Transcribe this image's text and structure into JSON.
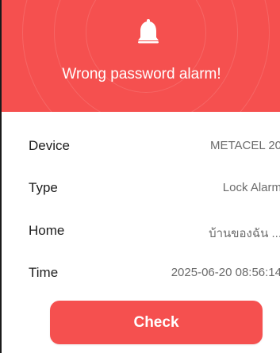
{
  "header": {
    "icon": "bell-icon",
    "title": "Wrong password alarm!"
  },
  "details": [
    {
      "label": "Device",
      "value": "METACEL 20"
    },
    {
      "label": "Type",
      "value": "Lock Alarm"
    },
    {
      "label": "Home",
      "value": "บ้านของฉัน ..."
    },
    {
      "label": "Time",
      "value": "2025-06-20 08:56:14"
    }
  ],
  "actions": {
    "check_label": "Check"
  },
  "colors": {
    "accent": "#f5504f"
  }
}
